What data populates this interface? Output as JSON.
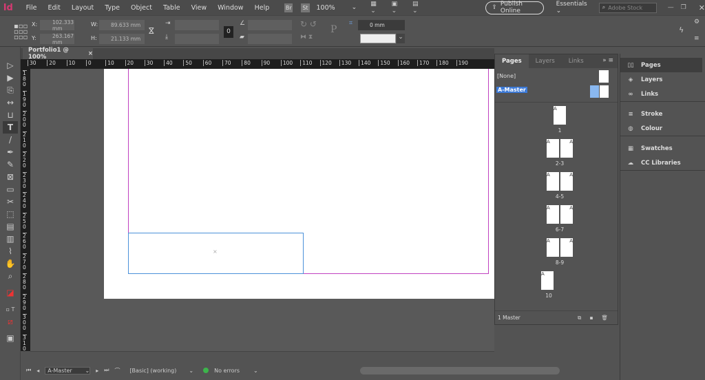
{
  "app": {
    "logo": "Id"
  },
  "menu": [
    "File",
    "Edit",
    "Layout",
    "Type",
    "Object",
    "Table",
    "View",
    "Window",
    "Help"
  ],
  "menubar": {
    "bridge": "Br",
    "stock": "St",
    "zoom": "100%",
    "publish": "Publish Online",
    "workspace": "Essentials",
    "search_placeholder": "Adobe Stock"
  },
  "control": {
    "x_label": "X:",
    "x": "102.333 mm",
    "y_label": "Y:",
    "y": "263.167 mm",
    "w_label": "W:",
    "w": "89.633 mm",
    "h_label": "H:",
    "h": "21.133 mm",
    "stroke": "0 mm"
  },
  "document_tab": {
    "title": "Portfolio1 @ 100%",
    "close": "×"
  },
  "hruler": [
    "30",
    "20",
    "10",
    "0",
    "10",
    "20",
    "30",
    "40",
    "50",
    "60",
    "70",
    "80",
    "90",
    "100",
    "110",
    "120",
    "130",
    "140",
    "150",
    "160",
    "170",
    "180",
    "190"
  ],
  "vruler": [
    "180",
    "190",
    "200",
    "210",
    "220",
    "230",
    "240",
    "250",
    "260",
    "270",
    "280",
    "290",
    "300",
    "310"
  ],
  "pages_panel": {
    "tabs": [
      "Pages",
      "Layers",
      "Links"
    ],
    "none": "[None]",
    "master": "A-Master",
    "pages": [
      {
        "label": "1",
        "left": "",
        "right": "A"
      },
      {
        "label": "2-3",
        "left": "A",
        "right": "A"
      },
      {
        "label": "4-5",
        "left": "A",
        "right": "A"
      },
      {
        "label": "6-7",
        "left": "A",
        "right": "A"
      },
      {
        "label": "8-9",
        "left": "A",
        "right": "A"
      },
      {
        "label": "10",
        "left": "A",
        "right": ""
      }
    ],
    "footer": "1 Master"
  },
  "dock": [
    {
      "label": "Pages",
      "icon": "pages-icon"
    },
    {
      "label": "Layers",
      "icon": "layers-icon"
    },
    {
      "label": "Links",
      "icon": "links-icon"
    },
    {
      "label": "Stroke",
      "icon": "stroke-icon"
    },
    {
      "label": "Colour",
      "icon": "colour-icon"
    },
    {
      "label": "Swatches",
      "icon": "swatches-icon"
    },
    {
      "label": "CC Libraries",
      "icon": "cc-libraries-icon"
    }
  ],
  "status": {
    "page": "A-Master",
    "preflight_profile": "[Basic] (working)",
    "errors": "No errors"
  },
  "colors": {
    "accent": "#d63a72",
    "margin": "#c040c0",
    "frame": "#4a90d9",
    "ok": "#3cb44b"
  }
}
